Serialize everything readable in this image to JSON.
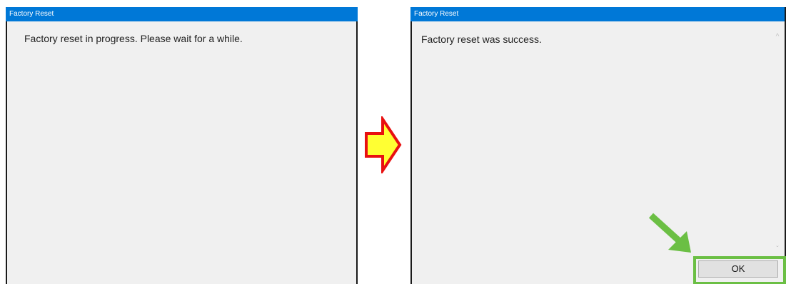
{
  "left_window": {
    "title": "Factory Reset",
    "message": "Factory reset in progress. Please wait for a while."
  },
  "right_window": {
    "title": "Factory Reset",
    "message": "Factory reset was success.",
    "ok_label": "OK"
  },
  "icons": {
    "transition_arrow": "arrow-right-icon",
    "pointer_arrow": "arrow-down-right-icon",
    "scroll_up": "chevron-up-icon",
    "scroll_down": "chevron-down-icon"
  },
  "colors": {
    "titlebar": "#0078d7",
    "window_bg": "#f0f0f0",
    "transition_arrow_fill": "#ffff33",
    "transition_arrow_stroke": "#e81010",
    "highlight": "#6bbf44"
  }
}
